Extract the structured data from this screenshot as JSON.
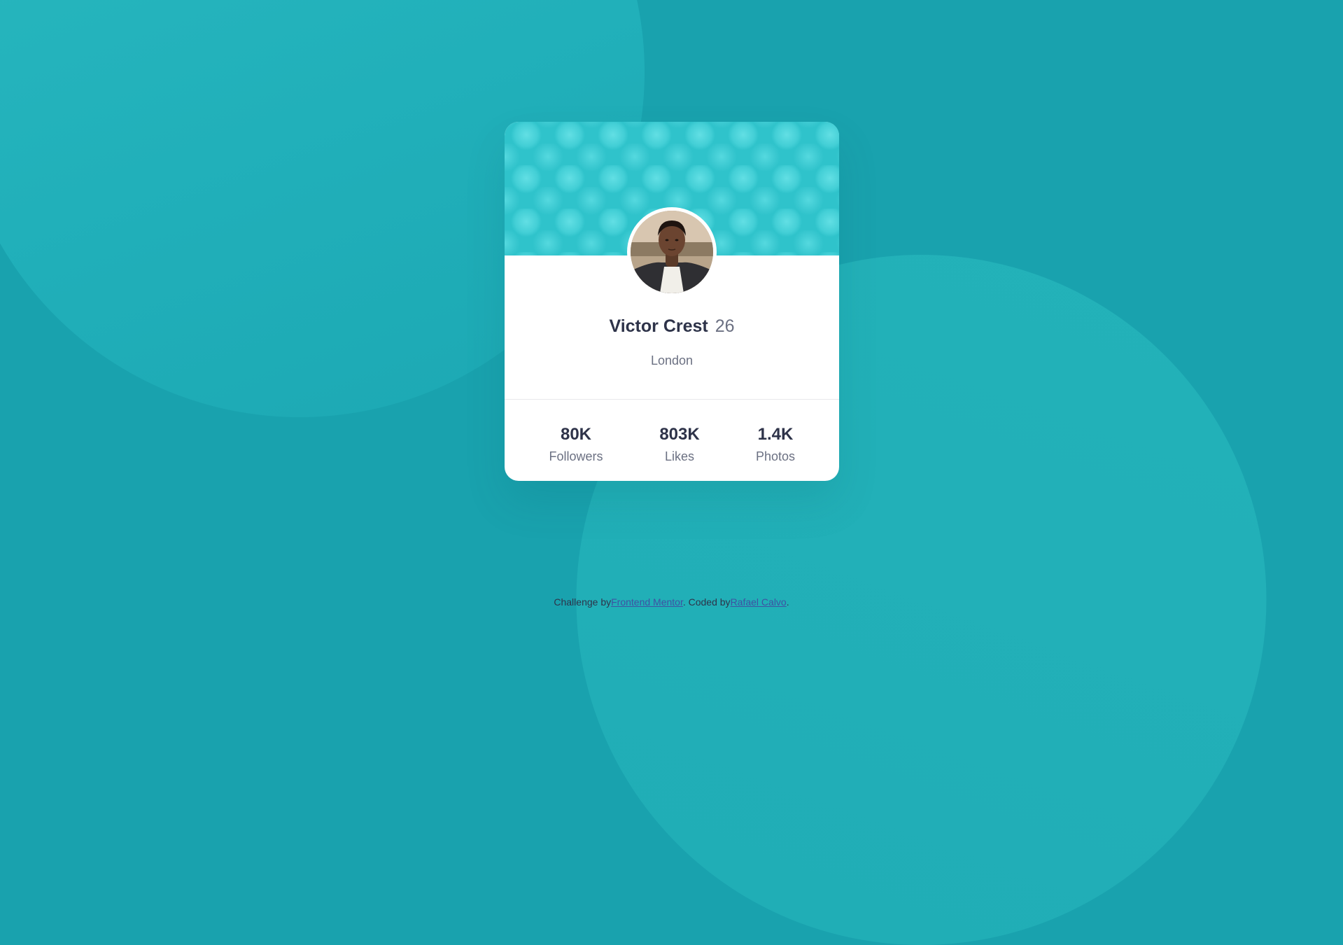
{
  "card": {
    "name": "Victor Crest",
    "age": "26",
    "location": "London",
    "stats": [
      {
        "value": "80K",
        "label": "Followers"
      },
      {
        "value": "803K",
        "label": "Likes"
      },
      {
        "value": "1.4K",
        "label": "Photos"
      }
    ]
  },
  "footer": {
    "prefix": "Challenge by",
    "challenge_link": "Frontend Mentor",
    "middle": ". Coded by",
    "author_link": "Rafael Calvo",
    "suffix": "."
  },
  "colors": {
    "background": "#19a2ae",
    "banner": "#2fc3cb",
    "text_dark": "#2e3349",
    "text_muted": "#6b7082",
    "link": "#3e52a3"
  },
  "icons": {
    "avatar": "profile-photo"
  }
}
